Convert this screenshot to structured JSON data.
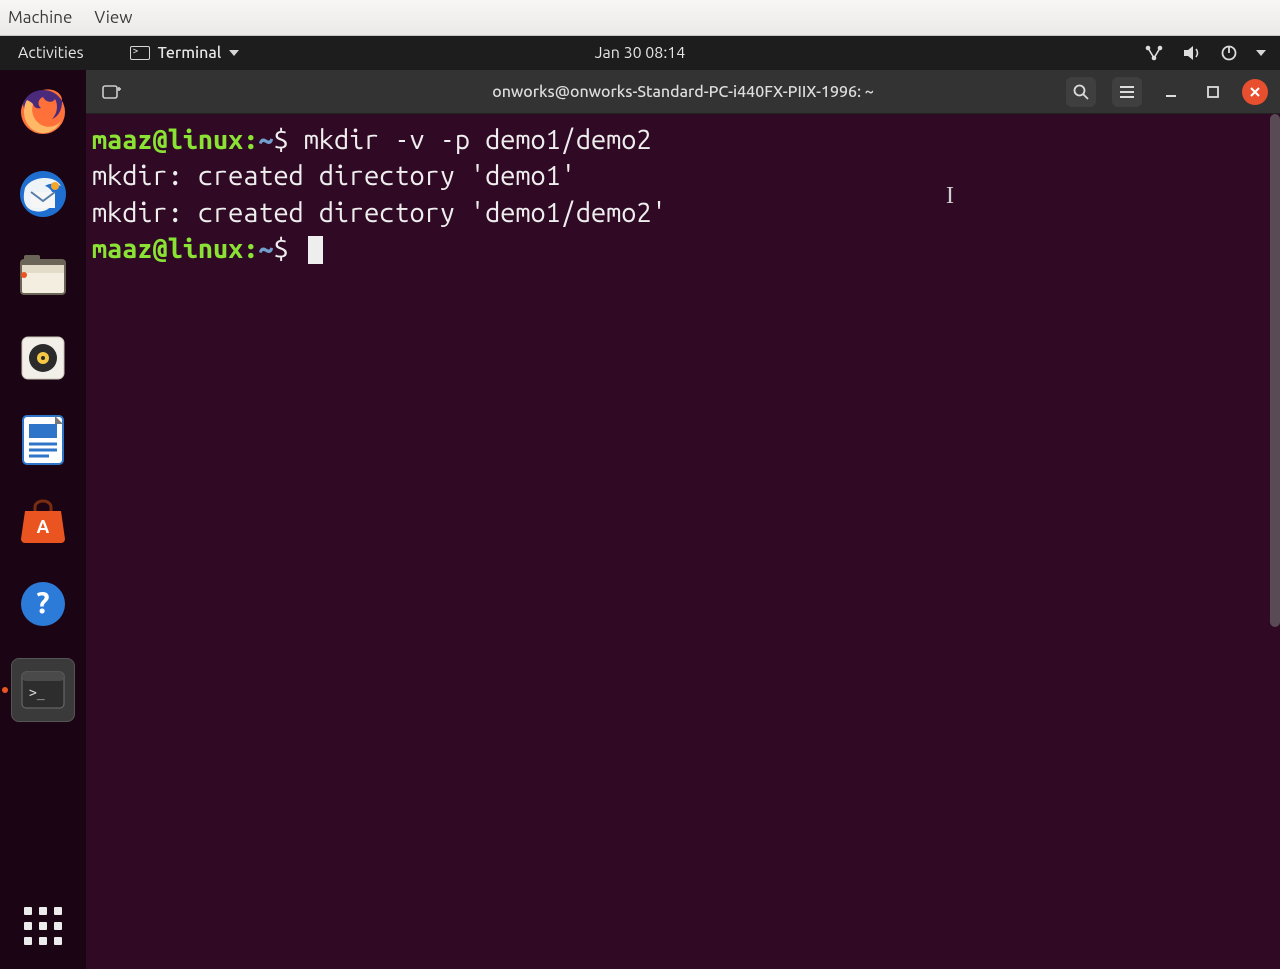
{
  "vm_menu": {
    "machine": "Machine",
    "view": "View"
  },
  "topbar": {
    "activities": "Activities",
    "app_name": "Terminal",
    "clock": "Jan 30  08:14"
  },
  "dock": {
    "items": [
      {
        "name": "firefox-icon"
      },
      {
        "name": "thunderbird-icon"
      },
      {
        "name": "files-icon",
        "running": true
      },
      {
        "name": "rhythmbox-icon"
      },
      {
        "name": "libreoffice-writer-icon"
      },
      {
        "name": "ubuntu-software-icon"
      },
      {
        "name": "help-icon"
      },
      {
        "name": "terminal-icon",
        "running": true,
        "active": true
      }
    ],
    "show_apps": "show-applications"
  },
  "terminal": {
    "title": "onworks@onworks-Standard-PC-i440FX-PIIX-1996: ~",
    "lines": [
      {
        "type": "prompt",
        "user_host": "maaz@linux",
        "sep": ":",
        "path": "~",
        "dollar": "$",
        "command": "mkdir -v -p demo1/demo2"
      },
      {
        "type": "output",
        "text": "mkdir: created directory 'demo1'"
      },
      {
        "type": "output",
        "text": "mkdir: created directory 'demo1/demo2'"
      },
      {
        "type": "prompt",
        "user_host": "maaz@linux",
        "sep": ":",
        "path": "~",
        "dollar": "$",
        "command": "",
        "cursor": true
      }
    ]
  }
}
